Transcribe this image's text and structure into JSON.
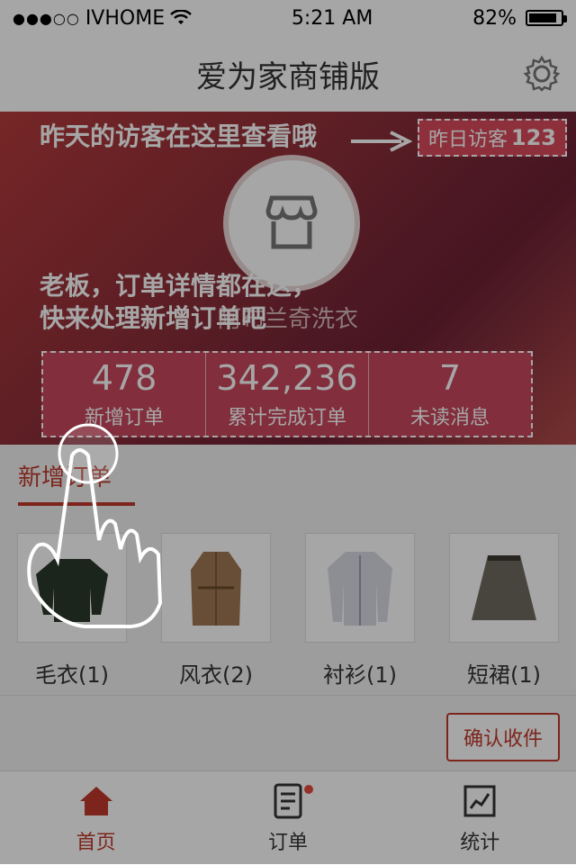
{
  "status_bar": {
    "carrier": "IVHOME",
    "time": "5:21 AM",
    "battery": "82%"
  },
  "nav": {
    "title": "爱为家商铺版",
    "settings_icon": "gear-icon"
  },
  "hero": {
    "store_name": "阿布兰奇洗衣",
    "yesterday_visitors_label": "昨日访客",
    "yesterday_visitors_value": "123",
    "guide_visitors": "昨天的访客在这里查看哦",
    "guide_orders_line1": "老板，订单详情都在这，",
    "guide_orders_line2": "快来处理新增订单吧",
    "stats": [
      {
        "value": "478",
        "label": "新增订单"
      },
      {
        "value": "342,236",
        "label": "累计完成订单"
      },
      {
        "value": "7",
        "label": "未读消息"
      }
    ]
  },
  "section": {
    "tab_label": "新增订单",
    "items": [
      {
        "label": "毛衣(1)",
        "icon": "sweater-icon"
      },
      {
        "label": "风衣(2)",
        "icon": "trench-coat-icon"
      },
      {
        "label": "衬衫(1)",
        "icon": "shirt-icon"
      },
      {
        "label": "短裙(1)",
        "icon": "skirt-icon"
      }
    ],
    "confirm_button": "确认收件"
  },
  "tabbar": {
    "items": [
      {
        "label": "首页",
        "icon": "home-icon",
        "active": true
      },
      {
        "label": "订单",
        "icon": "orders-icon",
        "badge": true
      },
      {
        "label": "统计",
        "icon": "stats-icon"
      }
    ]
  },
  "colors": {
    "accent": "#c0392b",
    "hero_start": "#b53b3b",
    "hero_end": "#6b2134",
    "stat_bg": "#c8485d"
  }
}
